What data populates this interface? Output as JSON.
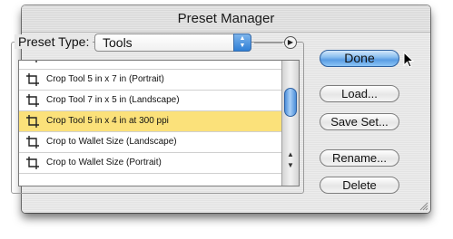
{
  "window": {
    "title": "Preset Manager"
  },
  "preset_type": {
    "label": "Preset Type:",
    "selected": "Tools"
  },
  "presets": [
    {
      "label": "Crop Tool 5 in x 7 in (Portrait)",
      "selected": false
    },
    {
      "label": "Crop Tool 7 in x 5 in (Landscape)",
      "selected": false
    },
    {
      "label": "Crop Tool 5 in x 4 in at 300 ppi",
      "selected": true
    },
    {
      "label": "Crop to Wallet Size (Landscape)",
      "selected": false
    },
    {
      "label": "Crop to Wallet Size (Portrait)",
      "selected": false
    }
  ],
  "buttons": {
    "done": "Done",
    "load": "Load...",
    "save_set": "Save Set...",
    "rename": "Rename...",
    "delete": "Delete"
  },
  "colors": {
    "selection": "#fbe17a",
    "accent": "#5a9de4"
  },
  "icons": {
    "row_icon": "crop-tool-icon",
    "flyout": "flyout-menu-icon"
  }
}
